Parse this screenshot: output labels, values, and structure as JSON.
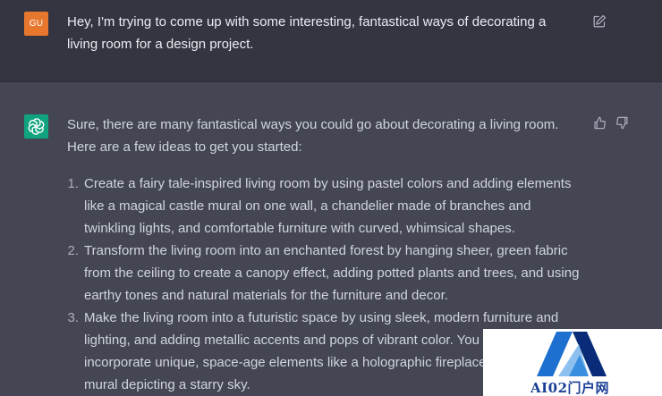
{
  "user_message": {
    "avatar_initials": "GU",
    "text": "Hey, I'm trying to come up with some interesting, fantastical ways of decorating a living room for a design project.",
    "edit_icon": "edit-icon"
  },
  "assistant_message": {
    "avatar_icon": "openai-logo-icon",
    "intro": "Sure, there are many fantastical ways you could go about decorating a living room. Here are a few ideas to get you started:",
    "ideas": [
      {
        "num": "1.",
        "text": "Create a fairy tale-inspired living room by using pastel colors and adding elements like a magical castle mural on one wall, a chandelier made of branches and twinkling lights, and comfortable furniture with curved, whimsical shapes."
      },
      {
        "num": "2.",
        "text": "Transform the living room into an enchanted forest by hanging sheer, green fabric from the ceiling to create a canopy effect, adding potted plants and trees, and using earthy tones and natural materials for the furniture and decor."
      },
      {
        "num": "3.",
        "text": "Make the living room into a futuristic space by using sleek, modern furniture and lighting, and adding metallic accents and pops of vibrant color. You could also incorporate unique, space-age elements like a holographic fireplace or a ceiling mural depicting a starry sky."
      }
    ],
    "feedback_icons": [
      "thumbs-up-icon",
      "thumbs-down-icon"
    ]
  },
  "watermark": {
    "text": "AI02门户网"
  },
  "colors": {
    "user_bg": "#343541",
    "assistant_bg": "#444654",
    "user_avatar": "#e8772e",
    "assistant_avatar": "#10a37f",
    "watermark_text": "#1a3f95"
  }
}
